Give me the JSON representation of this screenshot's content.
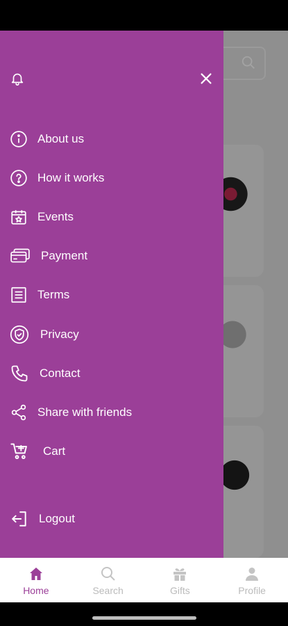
{
  "accent": "#9b3f98",
  "drawer": {
    "header": {
      "left_icon": "bell-icon",
      "right_icon": "close-icon"
    },
    "menu": [
      {
        "icon": "info-icon",
        "label": "About us"
      },
      {
        "icon": "question-icon",
        "label": "How it works"
      },
      {
        "icon": "calendar-star-icon",
        "label": "Events"
      },
      {
        "icon": "credit-card-icon",
        "label": "Payment"
      },
      {
        "icon": "document-icon",
        "label": "Terms"
      },
      {
        "icon": "shield-icon",
        "label": "Privacy"
      },
      {
        "icon": "phone-icon",
        "label": "Contact"
      },
      {
        "icon": "share-icon",
        "label": "Share with friends"
      },
      {
        "icon": "cart-icon",
        "label": "Cart"
      }
    ],
    "logout": {
      "icon": "logout-icon",
      "label": "Logout"
    }
  },
  "bottom_nav": [
    {
      "icon": "home-icon",
      "label": "Home",
      "active": true
    },
    {
      "icon": "search-icon",
      "label": "Search",
      "active": false
    },
    {
      "icon": "gift-icon",
      "label": "Gifts",
      "active": false
    },
    {
      "icon": "profile-icon",
      "label": "Profile",
      "active": false
    }
  ]
}
